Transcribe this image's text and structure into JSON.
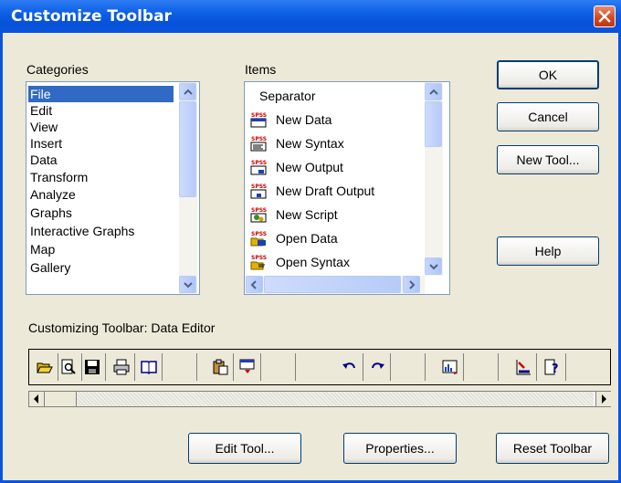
{
  "window": {
    "title": "Customize Toolbar",
    "close": "close-icon"
  },
  "categories": {
    "label": "Categories",
    "items": [
      "File",
      "Edit",
      "View",
      "Insert",
      "Data",
      "Transform",
      "Analyze",
      "Graphs",
      "Interactive Graphs",
      "Map",
      "Gallery"
    ],
    "selected": "File"
  },
  "items": {
    "label": "Items",
    "list": [
      {
        "label": "Separator",
        "icon": ""
      },
      {
        "label": "New Data",
        "icon": "spss-new-data-icon"
      },
      {
        "label": "New Syntax",
        "icon": "spss-new-syntax-icon"
      },
      {
        "label": "New Output",
        "icon": "spss-new-output-icon"
      },
      {
        "label": "New Draft Output",
        "icon": "spss-new-draft-output-icon"
      },
      {
        "label": "New Script",
        "icon": "spss-new-script-icon"
      },
      {
        "label": "Open Data",
        "icon": "spss-open-data-icon"
      },
      {
        "label": "Open Syntax",
        "icon": "spss-open-syntax-icon"
      }
    ]
  },
  "buttons": {
    "ok": "OK",
    "cancel": "Cancel",
    "new_tool": "New Tool...",
    "help": "Help",
    "edit_tool": "Edit Tool...",
    "properties": "Properties...",
    "reset_toolbar": "Reset Toolbar"
  },
  "customizing": {
    "label": "Customizing Toolbar: Data Editor"
  },
  "toolbar_icons": [
    "open-folder-icon",
    "print-preview-icon",
    "save-icon",
    "print-icon",
    "book-icon",
    "blank",
    "paste-icon",
    "dialog-recall-icon",
    "blank",
    "undo-icon",
    "redo-icon",
    "blank",
    "chart-icon",
    "blank",
    "goto-case-icon",
    "variables-icon"
  ],
  "colors": {
    "title_bar": "#0a54e2",
    "selection": "#316ac5",
    "close_button": "#d2461f",
    "dialog_face": "#ece9d8"
  }
}
